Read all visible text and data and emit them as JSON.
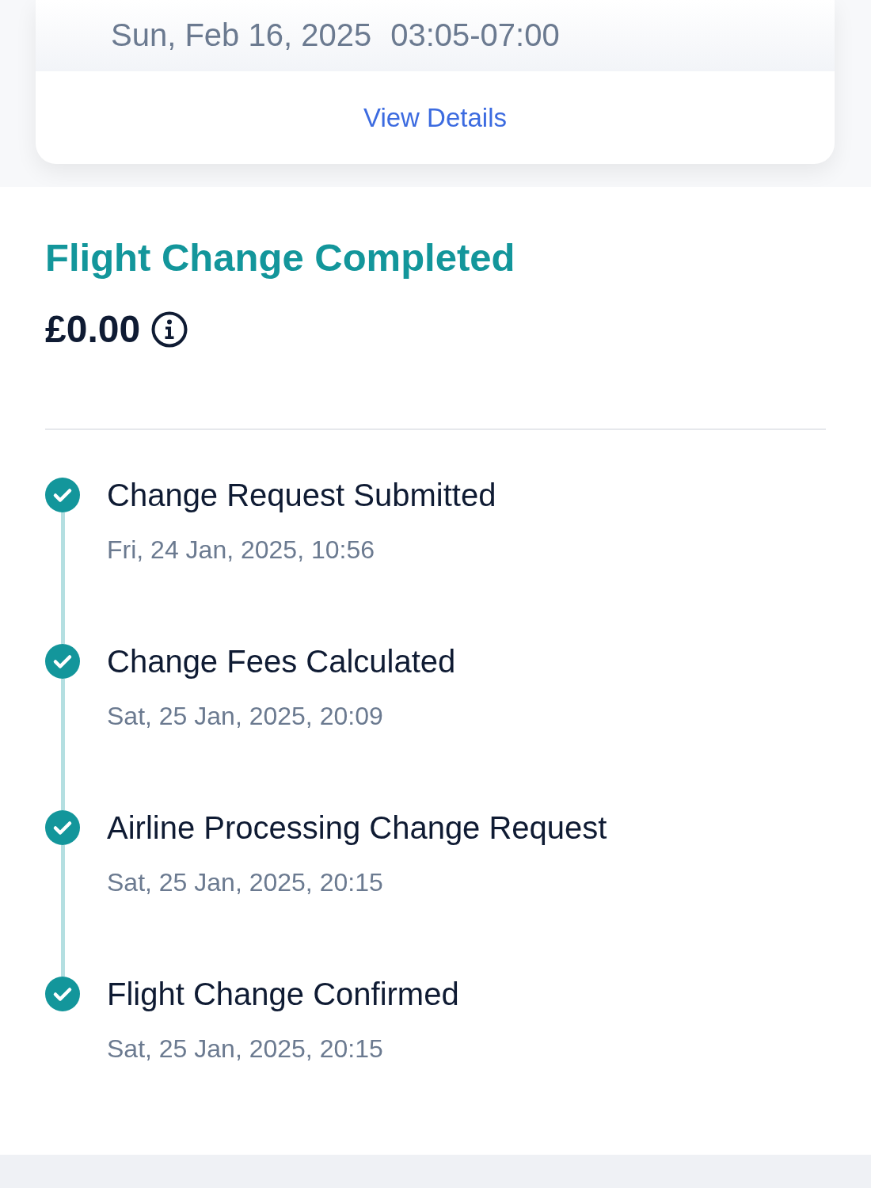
{
  "trip_card": {
    "date": "Sun, Feb 16, 2025",
    "time": "03:05-07:00",
    "link": "View Details"
  },
  "change_status": {
    "title": "Flight Change Completed",
    "amount": "£0.00"
  },
  "timeline": [
    {
      "title": "Change Request Submitted",
      "date": "Fri, 24 Jan, 2025, 10:56",
      "completed": true
    },
    {
      "title": "Change Fees Calculated",
      "date": "Sat, 25 Jan, 2025, 20:09",
      "completed": true
    },
    {
      "title": "Airline Processing Change Request",
      "date": "Sat, 25 Jan, 2025, 20:15",
      "completed": true
    },
    {
      "title": "Flight Change Confirmed",
      "date": "Sat, 25 Jan, 2025, 20:15",
      "completed": true
    }
  ]
}
